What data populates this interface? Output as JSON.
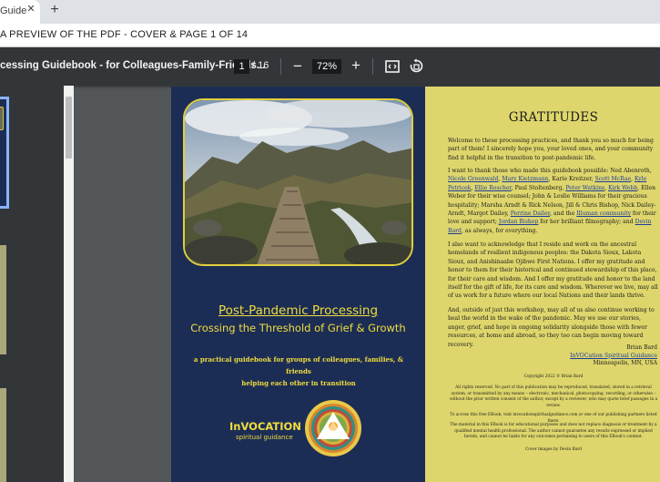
{
  "browser": {
    "tab_title": "Guide",
    "tab_close_icon": "close-icon",
    "new_tab_label": "+"
  },
  "banner": {
    "text": "A PREVIEW OF THE PDF - COVER & PAGE 1 OF 14"
  },
  "toolbar": {
    "doc_title": "cessing Guidebook - for Colleagues-Family-Friends...",
    "current_page": "1",
    "total_pages": "/ 16",
    "zoom_out_label": "−",
    "zoom_value": "72%",
    "zoom_in_label": "+",
    "fit_icon": "fit-to-page-icon",
    "rotate_icon": "rotate-icon"
  },
  "cover": {
    "title": "Post-Pandemic Processing",
    "subtitle": "Crossing the Threshold of Grief & Growth",
    "tagline_line1": "a practical guidebook for groups of colleagues, families, & friends",
    "tagline_line2": "helping each other in transition",
    "brand_name": "InVOCATION",
    "brand_tag": "spiritual guidance",
    "accent_color": "#f0dd3e",
    "background_color": "#1c2d55"
  },
  "gratitudes": {
    "heading": "GRATITUDES",
    "p1": "Welcome to these processing practices, and thank you so much for being part of them! I sincerely hope you, your loved ones, and your community find it helpful in the transition to post-pandemic life.",
    "p2": {
      "a": "I want to thank those who made this guidebook possible: Ned Abenroth, ",
      "l1": "Nicole Greenwald",
      "b": ", ",
      "l2": "Mary Kietzmann",
      "c": ", Karie Kreitzer, ",
      "l3": "Scott McRae",
      "d": ", ",
      "l4": "Kyle Petricek",
      "e": ", ",
      "l5": "Ellie Roscher",
      "f": ", Paul Stoltenberg, ",
      "l6": "Peter Watkins",
      "g": ", ",
      "l7": "Kirk Webb",
      "h": ", Ellen Weber for their wise counsel; John & Leslie Williams for their gracious hospitality; Marsha Arndt & Rick Nelson, Jill & Chris Bishop, Nick Dailey-Arndt, Margot Dailey, ",
      "l8": "Perrine Dailey",
      "i": ", and the ",
      "l9": "Illuman community",
      "j": " for their love and support; ",
      "l10": "Jordan Bishop",
      "k": " for her brilliant filmography; and ",
      "l11": "Devin Bard",
      "m": ", as always, for everything."
    },
    "p3": "I also want to acknowledge that I reside and work on the ancestral homelands of resilient indigenous peoples: the Dakota Sioux, Lakota Sioux, and Anishinaabe Ojibwe First Nations. I offer my gratitude and honor to them for their historical and continued stewardship of this place, for their care and wisdom. And I offer my gratitude and honor to the land itself for the gift of life, for its care and wisdom. Wherever we live, may all of us work for a future where our local Nations and their lands thrive.",
    "p4": "And, outside of just this workshop, may all of us also continue working to heal the world in the wake of the pandemic. May we use our stories, anger, grief, and hope in ongoing solidarity alongside those with fewer resources, at home and abroad, so they too can begin moving toward recovery.",
    "sign_name": "Brian Bard",
    "sign_org": "InVOCation Spiritual Guidance",
    "sign_city": "Minneapolis, MN, USA",
    "copyright": "Copyright 2022 © Brian Bard",
    "rights": "All rights reserved. No part of this publication may be reproduced, translated, stored in a retrieval system, or transmitted by any means – electronic, mechanical, photocopying, recording, or otherwise – without the prior written consent of the author, except by a reviewer, who may quote brief passages in a review.",
    "access": "To access this free EBook, visit invocationspiritualguidance.com or one of our publishing partners listed there.",
    "disclaimer": "The material in this EBook is for educational purposes and does not replace diagnosis or treatment by a qualified mental health professional. The author cannot guarantee any results expressed or implied herein, and cannot be liable for any outcomes pertaining to users of this EBook's content.",
    "cover_credit": "Cover images by Devin Bard",
    "background_color": "#ded66c",
    "link_color": "#1d3d9a"
  }
}
